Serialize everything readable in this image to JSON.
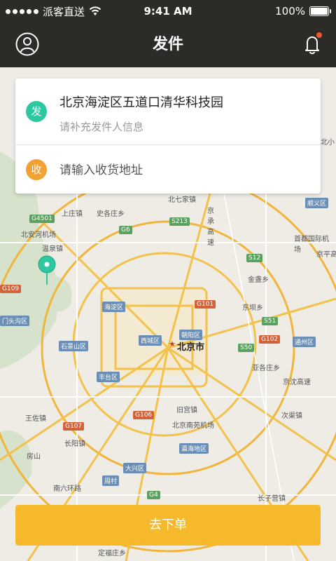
{
  "status_bar": {
    "carrier": "派客直送",
    "time": "9:41 AM",
    "battery": "100%",
    "battery_level": 1.0
  },
  "header": {
    "title": "发件",
    "profile_icon": "user-icon",
    "bell_icon": "bell-icon",
    "has_notification": true
  },
  "address_card": {
    "sender": {
      "badge": "发",
      "address": "北京海淀区五道口清华科技园",
      "hint": "请补充发件人信息",
      "badge_color": "#2dc7a0"
    },
    "receiver": {
      "badge": "收",
      "placeholder": "请输入收货地址",
      "badge_color": "#f2a135"
    }
  },
  "map": {
    "labels": [
      {
        "text": "北七家镇"
      },
      {
        "text": "上庄镇"
      },
      {
        "text": "史各庄乡"
      },
      {
        "text": "北安河机场"
      },
      {
        "text": "温泉镇"
      },
      {
        "text": "首都国际机场"
      },
      {
        "text": "金盏乡"
      },
      {
        "text": "东坝乡"
      },
      {
        "text": "北京市"
      },
      {
        "text": "亚各庄乡"
      },
      {
        "text": "次渠镇"
      },
      {
        "text": "旧宫镇"
      },
      {
        "text": "北京南苑机场"
      },
      {
        "text": "王佐镇"
      },
      {
        "text": "长阳镇"
      },
      {
        "text": "房山"
      },
      {
        "text": "南六环路"
      },
      {
        "text": "长子营镇"
      },
      {
        "text": "定福庄乡"
      },
      {
        "text": "北小"
      },
      {
        "text": "京平高"
      },
      {
        "text": "京沈高速"
      },
      {
        "text": "京承高速"
      }
    ],
    "tags": [
      {
        "text": "海淀区"
      },
      {
        "text": "西城区"
      },
      {
        "text": "朝阳区"
      },
      {
        "text": "石景山区"
      },
      {
        "text": "丰台区"
      },
      {
        "text": "通州区"
      },
      {
        "text": "顺义区"
      },
      {
        "text": "门头沟区"
      },
      {
        "text": "瀛海地区"
      },
      {
        "text": "大兴区"
      },
      {
        "text": "周村"
      },
      {
        "text": "G4501"
      },
      {
        "text": "G6"
      },
      {
        "text": "G101"
      },
      {
        "text": "G102"
      },
      {
        "text": "G107"
      },
      {
        "text": "G106"
      },
      {
        "text": "S50"
      },
      {
        "text": "S12"
      },
      {
        "text": "S51"
      },
      {
        "text": "G4"
      },
      {
        "text": "S213"
      },
      {
        "text": "G109"
      }
    ]
  },
  "order_button": {
    "label": "去下单",
    "color": "#f6b92b"
  }
}
